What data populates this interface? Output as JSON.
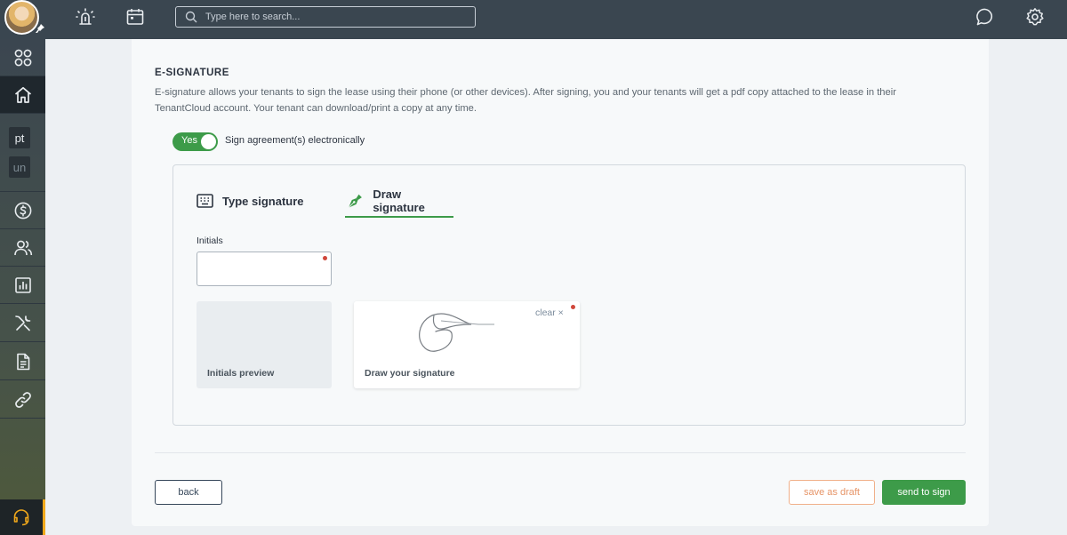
{
  "search": {
    "placeholder": "Type here to search..."
  },
  "sidebar": {
    "items": [
      {
        "icon": "apps-grid-icon"
      },
      {
        "icon": "home-icon"
      },
      {
        "label": "pt"
      },
      {
        "label": "un"
      },
      {
        "icon": "dollar-icon"
      },
      {
        "icon": "people-icon"
      },
      {
        "icon": "chart-icon"
      },
      {
        "icon": "tools-icon"
      },
      {
        "icon": "document-icon"
      },
      {
        "icon": "link-icon"
      }
    ],
    "support_icon": "headset-icon"
  },
  "esignature": {
    "title": "E-SIGNATURE",
    "description": "E-signature allows your tenants to sign the lease using their phone (or other devices). After signing, you and your tenants will get a pdf copy attached to the lease in their TenantCloud account. Your tenant can download/print a copy at any time.",
    "toggle_state": "Yes",
    "toggle_label": "Sign agreement(s) electronically",
    "tabs": {
      "type": "Type signature",
      "draw": "Draw signature",
      "active": "draw"
    },
    "initials_label": "Initials",
    "initials_value": "",
    "initials_preview": "Initials preview",
    "clear_label": "clear ×",
    "draw_hint": "Draw your signature"
  },
  "actions": {
    "back": "back",
    "save_draft": "save as draft",
    "send": "send to sign"
  },
  "colors": {
    "accent": "#3d9b49",
    "topbar": "#3a4650",
    "required": "#d0473b",
    "draft": "#e69467"
  }
}
